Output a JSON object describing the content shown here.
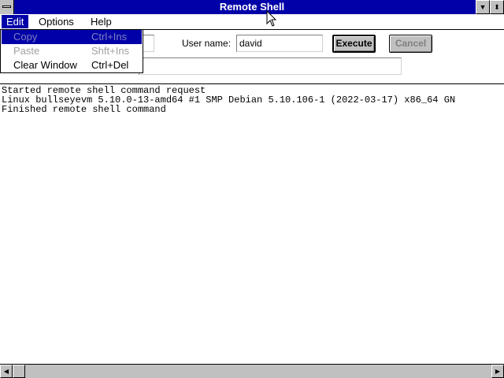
{
  "window": {
    "title": "Remote Shell",
    "minimize_icon": "minimize-arrow",
    "maximize_icon": "maximize-arrow"
  },
  "menubar": {
    "edit": "Edit",
    "options": "Options",
    "help": "Help"
  },
  "edit_menu": {
    "copy": {
      "label": "Copy",
      "accel": "Ctrl+Ins",
      "state": "highlighted-disabled"
    },
    "paste": {
      "label": "Paste",
      "accel": "Shft+Ins",
      "state": "disabled"
    },
    "clear": {
      "label": "Clear Window",
      "accel": "Ctrl+Del",
      "state": "enabled"
    }
  },
  "form": {
    "user_label": "User name:",
    "user_value": "david",
    "execute_label": "Execute",
    "cancel_label": "Cancel"
  },
  "output": {
    "lines": [
      "Started remote shell command request",
      "Linux bullseyevm 5.10.0-13-amd64 #1 SMP Debian 5.10.106-1 (2022-03-17) x86_64 GN",
      "Finished remote shell command"
    ]
  },
  "colors": {
    "titlebar": "#0000a8",
    "menu_highlight": "#0000a8",
    "face": "#c0c0c0"
  }
}
